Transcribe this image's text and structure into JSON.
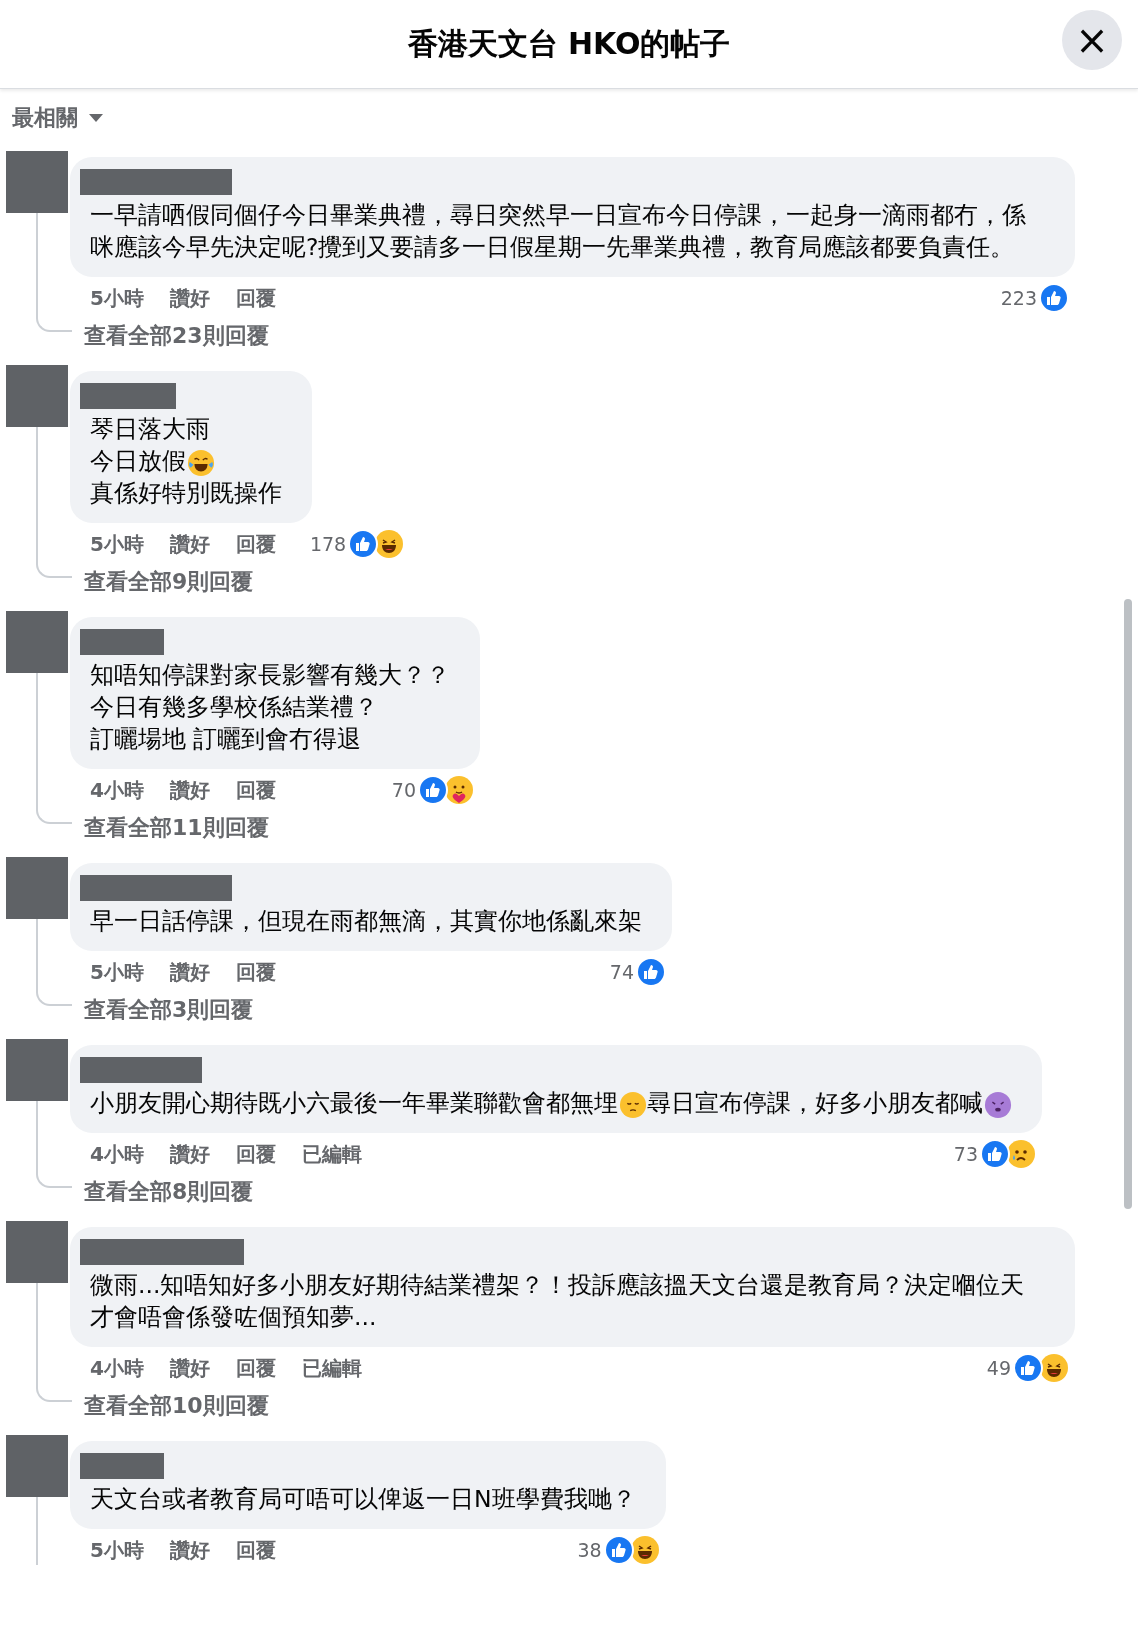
{
  "header": {
    "title": "香港天文台 HKO的帖子",
    "close": "×"
  },
  "sort": {
    "label": "最相關"
  },
  "comments": [
    {
      "lines": [
        [
          {
            "kind": "text",
            "text": "一早請哂假同個仔今日畢業典禮，尋日突然早一日宣布今日停課，一起身一滴雨都冇，係咪應該今早先決定呢?攪到又要請多一日假星期一先畢業典禮，教育局應該都要負責任。"
          }
        ]
      ],
      "time": "5小時",
      "like": "讚好",
      "reply": "回覆",
      "count": "223",
      "reactions": [
        {
          "kind": "like"
        }
      ],
      "replies_link": "查看全部23則回覆"
    },
    {
      "lines": [
        [
          {
            "kind": "text",
            "text": "琴日落大雨"
          }
        ],
        [
          {
            "kind": "text",
            "text": "今日放假"
          },
          {
            "kind": "laugh-cry"
          }
        ],
        [
          {
            "kind": "text",
            "text": "真係好特別既操作"
          }
        ]
      ],
      "time": "5小時",
      "like": "讚好",
      "reply": "回覆",
      "count": "178",
      "reactions": [
        {
          "kind": "like"
        },
        {
          "kind": "haha"
        }
      ],
      "replies_link": "查看全部9則回覆"
    },
    {
      "lines": [
        [
          {
            "kind": "text",
            "text": "知唔知停課對家長影響有幾大？？"
          }
        ],
        [
          {
            "kind": "text",
            "text": "今日有幾多學校係結業禮？"
          }
        ],
        [
          {
            "kind": "text",
            "text": "訂曬場地 訂曬到會冇得退"
          }
        ]
      ],
      "time": "4小時",
      "like": "讚好",
      "reply": "回覆",
      "count": "70",
      "reactions": [
        {
          "kind": "like"
        },
        {
          "kind": "care"
        }
      ],
      "replies_link": "查看全部11則回覆"
    },
    {
      "lines": [
        [
          {
            "kind": "text",
            "text": "早一日話停課，但現在雨都無滴，其實你地係亂來架"
          }
        ]
      ],
      "time": "5小時",
      "like": "讚好",
      "reply": "回覆",
      "count": "74",
      "reactions": [
        {
          "kind": "like"
        }
      ],
      "replies_link": "查看全部3則回覆"
    },
    {
      "lines": [
        [
          {
            "kind": "text",
            "text": "小朋友開心期待既小六最後一年畢業聯歡會都無埋"
          },
          {
            "kind": "pensive"
          },
          {
            "kind": "text",
            "text": "尋日宣布停課，好多小朋友都喊"
          },
          {
            "kind": "dizzy"
          }
        ]
      ],
      "time": "4小時",
      "like": "讚好",
      "reply": "回覆",
      "edited": "已編輯",
      "count": "73",
      "reactions": [
        {
          "kind": "like"
        },
        {
          "kind": "sad"
        }
      ],
      "replies_link": "查看全部8則回覆"
    },
    {
      "lines": [
        [
          {
            "kind": "text",
            "text": "微雨...知唔知好多小朋友好期待結業禮架？！投訴應該搵天文台還是教育局？決定嗰位天才會唔會係發咗個預知夢..."
          }
        ]
      ],
      "time": "4小時",
      "like": "讚好",
      "reply": "回覆",
      "edited": "已編輯",
      "count": "49",
      "reactions": [
        {
          "kind": "like"
        },
        {
          "kind": "haha"
        }
      ],
      "replies_link": "查看全部10則回覆"
    },
    {
      "lines": [
        [
          {
            "kind": "text",
            "text": "天文台或者教育局可唔可以俾返一日N班學費我哋？"
          }
        ]
      ],
      "time": "5小時",
      "like": "讚好",
      "reply": "回覆",
      "count": "38",
      "reactions": [
        {
          "kind": "like"
        },
        {
          "kind": "haha"
        }
      ]
    }
  ]
}
